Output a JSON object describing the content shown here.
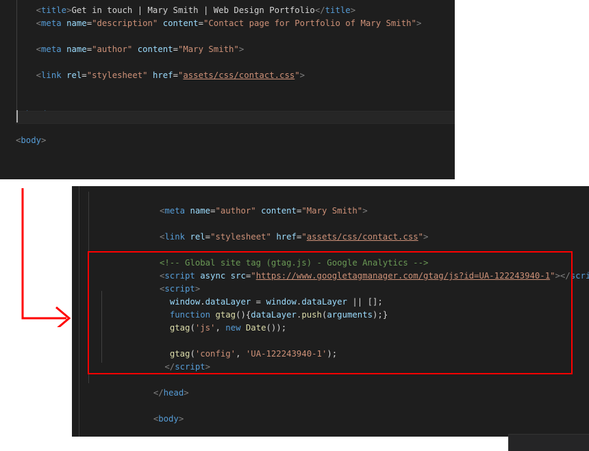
{
  "editor_top": {
    "name": "html-head-before-edit",
    "background": "#1e1e1e",
    "lines": [
      {
        "indent": 4,
        "segments": [
          {
            "t": "<",
            "c": "punc"
          },
          {
            "t": "title",
            "c": "tag"
          },
          {
            "t": ">",
            "c": "punc"
          },
          {
            "t": "Get in touch | Mary Smith | Web Design Portfolio",
            "c": "txt"
          },
          {
            "t": "</",
            "c": "punc"
          },
          {
            "t": "title",
            "c": "tag"
          },
          {
            "t": ">",
            "c": "punc"
          }
        ]
      },
      {
        "indent": 4,
        "segments": [
          {
            "t": "<",
            "c": "punc"
          },
          {
            "t": "meta",
            "c": "tag"
          },
          {
            "t": " ",
            "c": "txt"
          },
          {
            "t": "name",
            "c": "attr"
          },
          {
            "t": "=",
            "c": "txt"
          },
          {
            "t": "\"description\"",
            "c": "str"
          },
          {
            "t": " ",
            "c": "txt"
          },
          {
            "t": "content",
            "c": "attr"
          },
          {
            "t": "=",
            "c": "txt"
          },
          {
            "t": "\"Contact page for Portfolio of Mary Smith\"",
            "c": "str"
          },
          {
            "t": ">",
            "c": "punc"
          }
        ]
      },
      {
        "indent": 0,
        "segments": []
      },
      {
        "indent": 4,
        "segments": [
          {
            "t": "<",
            "c": "punc"
          },
          {
            "t": "meta",
            "c": "tag"
          },
          {
            "t": " ",
            "c": "txt"
          },
          {
            "t": "name",
            "c": "attr"
          },
          {
            "t": "=",
            "c": "txt"
          },
          {
            "t": "\"author\"",
            "c": "str"
          },
          {
            "t": " ",
            "c": "txt"
          },
          {
            "t": "content",
            "c": "attr"
          },
          {
            "t": "=",
            "c": "txt"
          },
          {
            "t": "\"Mary Smith\"",
            "c": "str"
          },
          {
            "t": ">",
            "c": "punc"
          }
        ]
      },
      {
        "indent": 0,
        "segments": []
      },
      {
        "indent": 4,
        "segments": [
          {
            "t": "<",
            "c": "punc"
          },
          {
            "t": "link",
            "c": "tag"
          },
          {
            "t": " ",
            "c": "txt"
          },
          {
            "t": "rel",
            "c": "attr"
          },
          {
            "t": "=",
            "c": "txt"
          },
          {
            "t": "\"stylesheet\"",
            "c": "str"
          },
          {
            "t": " ",
            "c": "txt"
          },
          {
            "t": "href",
            "c": "attr"
          },
          {
            "t": "=",
            "c": "txt"
          },
          {
            "t": "\"",
            "c": "str"
          },
          {
            "t": "assets/css/contact.css",
            "c": "link"
          },
          {
            "t": "\"",
            "c": "str"
          },
          {
            "t": ">",
            "c": "punc"
          }
        ]
      },
      {
        "indent": 0,
        "segments": []
      },
      {
        "indent": 0,
        "segments": []
      },
      {
        "indent": 0,
        "segments": [
          {
            "t": "</",
            "c": "punc"
          },
          {
            "t": "head",
            "c": "tag"
          },
          {
            "t": ">",
            "c": "punc"
          }
        ]
      },
      {
        "indent": 0,
        "segments": []
      },
      {
        "indent": 0,
        "segments": [
          {
            "t": "<",
            "c": "punc"
          },
          {
            "t": "body",
            "c": "tag"
          },
          {
            "t": ">",
            "c": "punc"
          }
        ]
      }
    ]
  },
  "editor_bottom": {
    "name": "html-head-after-edit",
    "background": "#1e1e1e",
    "lines": [
      {
        "indent": 0,
        "segments": []
      },
      {
        "indent": 0,
        "segments": [
          {
            "t": "<",
            "c": "punc"
          },
          {
            "t": "meta",
            "c": "tag"
          },
          {
            "t": " ",
            "c": "txt"
          },
          {
            "t": "name",
            "c": "attr"
          },
          {
            "t": "=",
            "c": "txt"
          },
          {
            "t": "\"author\"",
            "c": "str"
          },
          {
            "t": " ",
            "c": "txt"
          },
          {
            "t": "content",
            "c": "attr"
          },
          {
            "t": "=",
            "c": "txt"
          },
          {
            "t": "\"Mary Smith\"",
            "c": "str"
          },
          {
            "t": ">",
            "c": "punc"
          }
        ]
      },
      {
        "indent": 0,
        "segments": []
      },
      {
        "indent": 0,
        "segments": [
          {
            "t": "<",
            "c": "punc"
          },
          {
            "t": "link",
            "c": "tag"
          },
          {
            "t": " ",
            "c": "txt"
          },
          {
            "t": "rel",
            "c": "attr"
          },
          {
            "t": "=",
            "c": "txt"
          },
          {
            "t": "\"stylesheet\"",
            "c": "str"
          },
          {
            "t": " ",
            "c": "txt"
          },
          {
            "t": "href",
            "c": "attr"
          },
          {
            "t": "=",
            "c": "txt"
          },
          {
            "t": "\"",
            "c": "str"
          },
          {
            "t": "assets/css/contact.css",
            "c": "link"
          },
          {
            "t": "\"",
            "c": "str"
          },
          {
            "t": ">",
            "c": "punc"
          }
        ]
      },
      {
        "indent": 0,
        "segments": []
      },
      {
        "indent": 0,
        "segments": [
          {
            "t": "<!-- Global site tag (gtag.js) - Google Analytics -->",
            "c": "cmt"
          }
        ]
      },
      {
        "indent": 0,
        "segments": [
          {
            "t": "<",
            "c": "punc"
          },
          {
            "t": "script",
            "c": "tag"
          },
          {
            "t": " ",
            "c": "txt"
          },
          {
            "t": "async",
            "c": "attr"
          },
          {
            "t": " ",
            "c": "txt"
          },
          {
            "t": "src",
            "c": "attr"
          },
          {
            "t": "=",
            "c": "txt"
          },
          {
            "t": "\"",
            "c": "str"
          },
          {
            "t": "https://www.googletagmanager.com/gtag/js?id=UA-122243940-1",
            "c": "link"
          },
          {
            "t": "\"",
            "c": "str"
          },
          {
            "t": ">",
            "c": "punc"
          },
          {
            "t": "</",
            "c": "punc"
          },
          {
            "t": "script",
            "c": "tag"
          },
          {
            "t": ">",
            "c": "punc"
          }
        ]
      },
      {
        "indent": 0,
        "segments": [
          {
            "t": "<",
            "c": "punc"
          },
          {
            "t": "script",
            "c": "tag"
          },
          {
            "t": ">",
            "c": "punc"
          }
        ]
      },
      {
        "indent": 2,
        "segments": [
          {
            "t": "window",
            "c": "var"
          },
          {
            "t": ".",
            "c": "op"
          },
          {
            "t": "dataLayer",
            "c": "var"
          },
          {
            "t": " = ",
            "c": "op"
          },
          {
            "t": "window",
            "c": "var"
          },
          {
            "t": ".",
            "c": "op"
          },
          {
            "t": "dataLayer",
            "c": "var"
          },
          {
            "t": " || [];",
            "c": "op"
          }
        ]
      },
      {
        "indent": 2,
        "segments": [
          {
            "t": "function",
            "c": "kw"
          },
          {
            "t": " ",
            "c": "op"
          },
          {
            "t": "gtag",
            "c": "fn"
          },
          {
            "t": "(){",
            "c": "op"
          },
          {
            "t": "dataLayer",
            "c": "var"
          },
          {
            "t": ".",
            "c": "op"
          },
          {
            "t": "push",
            "c": "fn"
          },
          {
            "t": "(",
            "c": "op"
          },
          {
            "t": "arguments",
            "c": "var"
          },
          {
            "t": ");}",
            "c": "op"
          }
        ]
      },
      {
        "indent": 2,
        "segments": [
          {
            "t": "gtag",
            "c": "fn"
          },
          {
            "t": "(",
            "c": "op"
          },
          {
            "t": "'js'",
            "c": "str"
          },
          {
            "t": ", ",
            "c": "op"
          },
          {
            "t": "new",
            "c": "kw"
          },
          {
            "t": " ",
            "c": "op"
          },
          {
            "t": "Date",
            "c": "fn"
          },
          {
            "t": "());",
            "c": "op"
          }
        ]
      },
      {
        "indent": 0,
        "segments": []
      },
      {
        "indent": 2,
        "segments": [
          {
            "t": "gtag",
            "c": "fn"
          },
          {
            "t": "(",
            "c": "op"
          },
          {
            "t": "'config'",
            "c": "str"
          },
          {
            "t": ", ",
            "c": "op"
          },
          {
            "t": "'UA-122243940-1'",
            "c": "str"
          },
          {
            "t": ");",
            "c": "op"
          }
        ]
      },
      {
        "indent": 1,
        "segments": [
          {
            "t": "</",
            "c": "punc"
          },
          {
            "t": "script",
            "c": "tag"
          },
          {
            "t": ">",
            "c": "punc"
          }
        ]
      },
      {
        "indent": 0,
        "segments": []
      },
      {
        "indent": -1,
        "segments": [
          {
            "t": "</",
            "c": "punc"
          },
          {
            "t": "head",
            "c": "tag"
          },
          {
            "t": ">",
            "c": "punc"
          }
        ]
      },
      {
        "indent": 0,
        "segments": []
      },
      {
        "indent": -1,
        "segments": [
          {
            "t": "<",
            "c": "punc"
          },
          {
            "t": "body",
            "c": "tag"
          },
          {
            "t": ">",
            "c": "punc"
          }
        ]
      }
    ]
  },
  "annotations": {
    "highlight_box_color": "#ff0000",
    "arrow_color": "#ff0000",
    "arrow_description": "red-arrow-pointing-to-added-code"
  },
  "colors": {
    "editor_background": "#1e1e1e",
    "page_background": "#ffffff",
    "tag": "#569cd6",
    "attribute": "#9cdcfe",
    "string": "#ce9178",
    "comment": "#6a9955",
    "function": "#dcdcaa",
    "keyword": "#569cd6",
    "text": "#d4d4d4",
    "annotation_red": "#ff0000",
    "active_line": "#262626",
    "strip": "#252526"
  }
}
